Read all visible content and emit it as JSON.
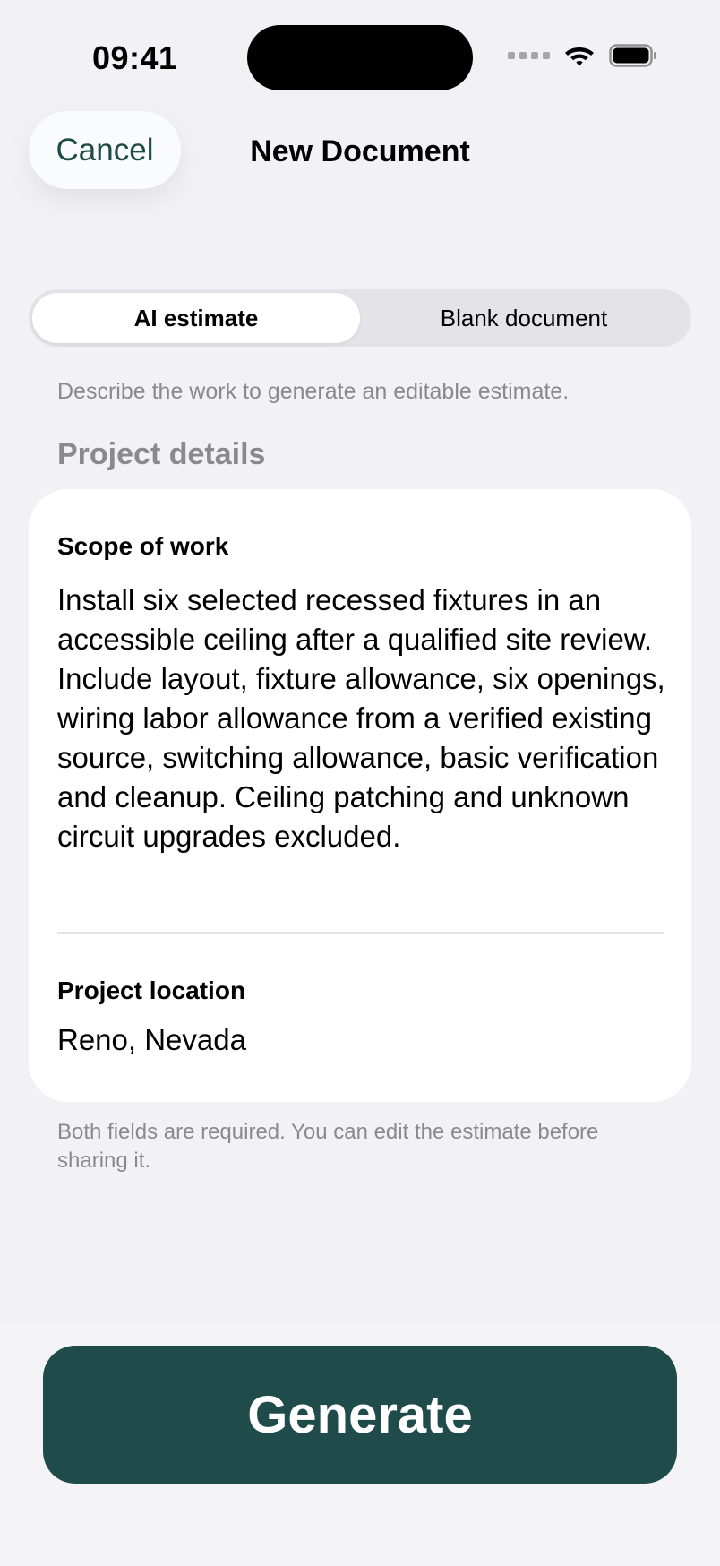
{
  "status_bar": {
    "time": "09:41",
    "icons": [
      "signal-dots-icon",
      "wifi-icon",
      "battery-icon"
    ]
  },
  "nav": {
    "cancel_label": "Cancel",
    "title": "New Document"
  },
  "segmented_control": {
    "options": [
      {
        "label": "AI estimate",
        "selected": true
      },
      {
        "label": "Blank document",
        "selected": false
      }
    ]
  },
  "description": "Describe the work to generate an editable estimate.",
  "section": {
    "header": "Project details"
  },
  "fields": {
    "scope": {
      "label": "Scope of work",
      "value": "Install six selected recessed fixtures in an accessible ceiling after a qualified site review. Include layout, fixture allowance, six openings, wiring labor allowance from a verified existing source, switching allowance, basic verification and cleanup. Ceiling patching and unknown circuit upgrades excluded."
    },
    "location": {
      "label": "Project location",
      "value": "Reno, Nevada"
    }
  },
  "footnote": "Both fields are required. You can edit the estimate before sharing it.",
  "primary_action": {
    "label": "Generate"
  },
  "colors": {
    "accent": "#1f4c4a",
    "background": "#f2f2f6",
    "secondary_text": "#8a8a8e"
  }
}
